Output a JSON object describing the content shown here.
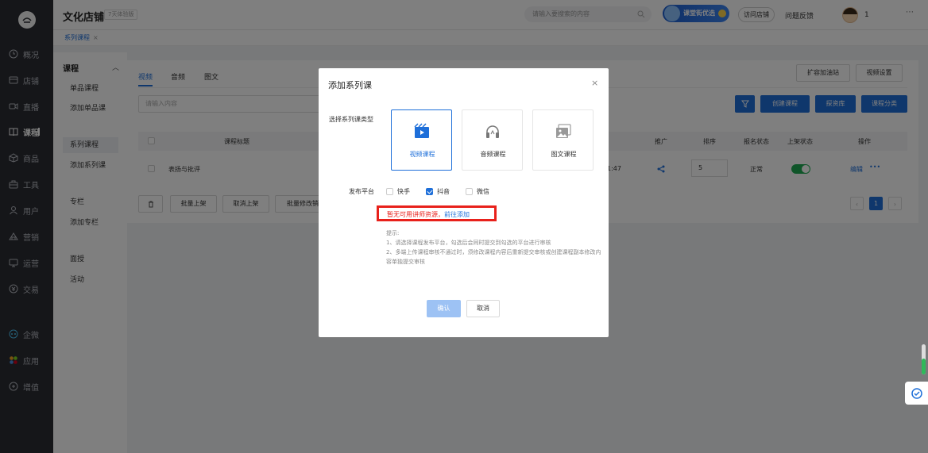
{
  "nav": {
    "items": [
      {
        "label": "概况",
        "icon": "clock-icon"
      },
      {
        "label": "店铺",
        "icon": "store-icon"
      },
      {
        "label": "直播",
        "icon": "video-icon"
      },
      {
        "label": "课程",
        "icon": "book-icon",
        "active": true
      },
      {
        "label": "商品",
        "icon": "box-icon"
      },
      {
        "label": "工具",
        "icon": "toolbox-icon"
      },
      {
        "label": "用户",
        "icon": "user-icon"
      },
      {
        "label": "营销",
        "icon": "marketing-icon"
      },
      {
        "label": "运营",
        "icon": "monitor-icon"
      },
      {
        "label": "交易",
        "icon": "coin-icon"
      },
      {
        "label": "企微",
        "icon": "wechat-work-icon"
      },
      {
        "label": "应用",
        "icon": "apps-icon"
      },
      {
        "label": "增值",
        "icon": "plus-circle-icon"
      }
    ]
  },
  "topbar": {
    "shop_name": "文化店铺",
    "trial_badge": "7天体验版",
    "search_placeholder": "请输入要搜索的内容",
    "promo_label": "课堂街优选",
    "visit_label": "访问店铺",
    "feedback_label": "问题反馈",
    "user_count": "1"
  },
  "page_tab": {
    "label": "系列课程",
    "close": "×"
  },
  "subnav": {
    "head": "课程",
    "items": [
      "单品课程",
      "添加单品课",
      "系列课程",
      "添加系列课",
      "专栏",
      "添加专栏",
      "面授",
      "活动"
    ],
    "selected": "系列课程"
  },
  "main": {
    "tabs": [
      "视频",
      "音频",
      "图文"
    ],
    "expand_label": "扩容加油站",
    "video_settings_label": "视频设置",
    "filter_placeholder": "请输入内容",
    "create_label": "创建课程",
    "library_label": "探资库",
    "category_label": "课程分类",
    "columns": {
      "title": "课程标题",
      "promote": "推广",
      "sort": "排序",
      "signup_status": "报名状态",
      "shelf_status": "上架状态",
      "actions": "操作"
    },
    "rows": [
      {
        "title": "表扬与批评",
        "time": "1:47",
        "sort": "5",
        "signup_status": "正常",
        "shelf_on": true,
        "edit": "编辑",
        "more": "•••"
      }
    ],
    "bulk": {
      "up": "批量上架",
      "down": "取消上架",
      "modify": "批量修改销"
    },
    "pagination": {
      "current": "1"
    }
  },
  "modal": {
    "title": "添加系列课",
    "close": "×",
    "type_label": "选择系列课类型",
    "types": [
      {
        "label": "视频课程",
        "icon": "video-course-icon",
        "selected": true
      },
      {
        "label": "音频课程",
        "icon": "audio-course-icon",
        "selected": false
      },
      {
        "label": "图文课程",
        "icon": "image-text-course-icon",
        "selected": false
      }
    ],
    "platform_label": "发布平台",
    "platforms": [
      {
        "label": "快手",
        "checked": false
      },
      {
        "label": "抖音",
        "checked": true
      },
      {
        "label": "微信",
        "checked": false
      }
    ],
    "warning_text": "暂无可用讲师资源，",
    "warning_link": "前往添加",
    "tips_title": "提示:",
    "tips": [
      "1、请选择课程发布平台，勾选后会同时提交到勾选的平台进行审核",
      "2、多端上传课程审核不通过时，须修改课程内容后重新提交审核或创建课程副本修改内容单独提交审核"
    ],
    "confirm_label": "确认",
    "cancel_label": "取消"
  },
  "colors": {
    "primary": "#1f6fd8",
    "warning": "#e8211b",
    "nav_bg": "#2b2d33",
    "toggle_on": "#1faa52"
  }
}
